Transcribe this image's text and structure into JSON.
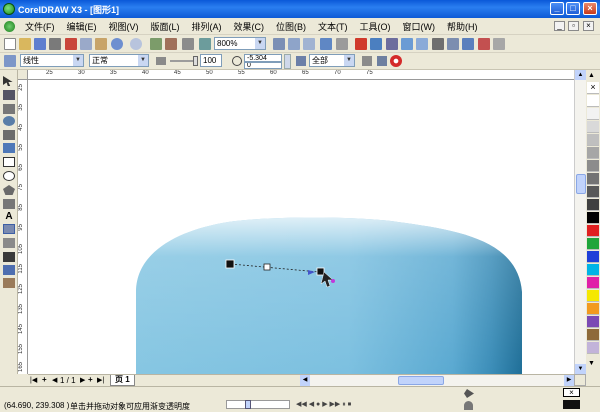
{
  "window": {
    "title": "CorelDRAW X3 - [图形1]"
  },
  "menu": {
    "items": [
      {
        "label": "文件(F)"
      },
      {
        "label": "编辑(E)"
      },
      {
        "label": "视图(V)"
      },
      {
        "label": "版面(L)"
      },
      {
        "label": "排列(A)"
      },
      {
        "label": "效果(C)"
      },
      {
        "label": "位图(B)"
      },
      {
        "label": "文本(T)"
      },
      {
        "label": "工具(O)"
      },
      {
        "label": "窗口(W)"
      },
      {
        "label": "帮助(H)"
      }
    ]
  },
  "toolbar": {
    "zoom_value": "800%"
  },
  "property_bar": {
    "transparency_type": "线性",
    "transparency_mode": "正常",
    "transparency_midpoint": "100",
    "angle_value": "-5.304",
    "edge_pad_value": "0",
    "apply_target": "全部"
  },
  "ruler": {
    "top_labels": [
      "25",
      "30",
      "35",
      "40",
      "45",
      "50",
      "55",
      "60",
      "65",
      "70",
      "75"
    ],
    "left_labels": [
      "25",
      "35",
      "45",
      "55",
      "65",
      "75",
      "85",
      "95",
      "105",
      "115",
      "125",
      "135",
      "145",
      "155",
      "165"
    ]
  },
  "pagebar": {
    "page_count": "1 / 1",
    "page_tab": "页 1"
  },
  "statusbar": {
    "coords": "(64.690, 239.308 )",
    "hint": "单击并拖动对象可应用渐变透明度"
  },
  "colors": {
    "title_bar": "#0a58d8",
    "shape_light": "#c2e0f1",
    "shape_mid": "#7ec1e0",
    "shape_dark": "#2b7ea6",
    "handle_arrow": "#4455cc"
  }
}
